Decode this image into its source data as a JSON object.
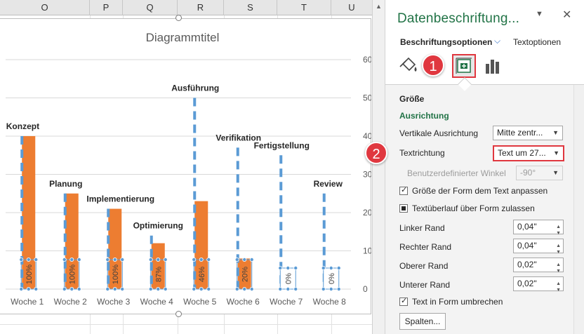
{
  "sheet": {
    "columns": [
      "O",
      "P",
      "Q",
      "R",
      "S",
      "T",
      "U"
    ]
  },
  "chart_data": {
    "type": "bar",
    "title": "Diagrammtitel",
    "categories": [
      "Woche 1",
      "Woche 2",
      "Woche 3",
      "Woche 4",
      "Woche 5",
      "Woche 6",
      "Woche 7",
      "Woche 8"
    ],
    "phases": [
      "Konzept",
      "Planung",
      "Implementierung",
      "Optimierung",
      "Ausführung",
      "Verifikation",
      "Fertigstellung",
      "Review"
    ],
    "series": [
      {
        "values": [
          40,
          25,
          21,
          12,
          23,
          8,
          0,
          0
        ],
        "color": "#ed7d31"
      },
      {
        "values": [
          40,
          25,
          21,
          14,
          50,
          37,
          35,
          25
        ],
        "color": "#5b9bd5",
        "style": "dashed"
      }
    ],
    "data_labels": [
      "100%",
      "100%",
      "100%",
      "87%",
      "46%",
      "20%",
      "0%",
      "0%"
    ],
    "y_ticks": [
      "60",
      "50",
      "40",
      "30",
      "20",
      "10",
      "0"
    ],
    "ylim": [
      0,
      60
    ],
    "grid": true
  },
  "pane": {
    "title": "Datenbeschriftung...",
    "tab_active": "Beschriftungsoptionen",
    "tab_other": "Textoptionen",
    "section_size": "Größe",
    "section_alignment": "Ausrichtung",
    "vertical_alignment_label": "Vertikale Ausrichtung",
    "vertical_alignment_value": "Mitte zentr...",
    "text_direction_label": "Textrichtung",
    "text_direction_value": "Text um 27...",
    "custom_angle_label": "Benutzerdefinierter Winkel",
    "custom_angle_value": "-90°",
    "resize_shape_label": "Größe der Form dem Text anpassen",
    "overflow_label": "Textüberlauf über Form zulassen",
    "left_margin_label": "Linker Rand",
    "left_margin_value": "0,04\"",
    "right_margin_label": "Rechter Rand",
    "right_margin_value": "0,04\"",
    "top_margin_label": "Oberer Rand",
    "top_margin_value": "0,02\"",
    "bottom_margin_label": "Unterer Rand",
    "bottom_margin_value": "0,02\"",
    "wrap_label": "Text in Form umbrechen",
    "columns_button": "Spalten..."
  },
  "callouts": [
    "1",
    "2"
  ],
  "icons": {
    "fill": "paint-bucket-icon",
    "size": "size-properties-icon",
    "chart": "bar-chart-icon",
    "close": "close-icon",
    "dropdown": "chevron-down-icon"
  }
}
